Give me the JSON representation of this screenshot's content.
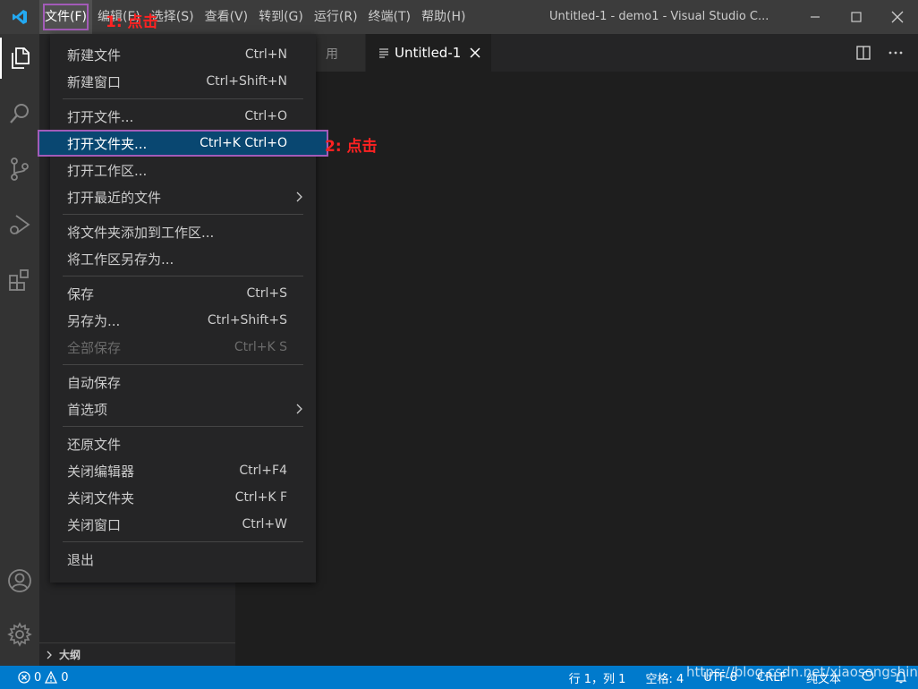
{
  "titlebar": {
    "menus": [
      {
        "label": "文件(F)"
      },
      {
        "label": "编辑(E)"
      },
      {
        "label": "选择(S)"
      },
      {
        "label": "查看(V)"
      },
      {
        "label": "转到(G)"
      },
      {
        "label": "运行(R)"
      },
      {
        "label": "终端(T)"
      },
      {
        "label": "帮助(H)"
      }
    ],
    "window_title": "Untitled-1 - demo1 - Visual Studio C..."
  },
  "tabs": {
    "inactive_label": "用",
    "active_label": "Untitled-1"
  },
  "file_menu": {
    "groups": [
      [
        {
          "label": "新建文件",
          "shortcut": "Ctrl+N"
        },
        {
          "label": "新建窗口",
          "shortcut": "Ctrl+Shift+N"
        }
      ],
      [
        {
          "label": "打开文件...",
          "shortcut": "Ctrl+O"
        },
        {
          "label": "打开文件夹...",
          "shortcut": "Ctrl+K Ctrl+O"
        },
        {
          "label": "打开工作区...",
          "shortcut": ""
        },
        {
          "label": "打开最近的文件",
          "shortcut": ""
        }
      ],
      [
        {
          "label": "将文件夹添加到工作区...",
          "shortcut": ""
        },
        {
          "label": "将工作区另存为...",
          "shortcut": ""
        }
      ],
      [
        {
          "label": "保存",
          "shortcut": "Ctrl+S"
        },
        {
          "label": "另存为...",
          "shortcut": "Ctrl+Shift+S"
        },
        {
          "label": "全部保存",
          "shortcut": "Ctrl+K S"
        }
      ],
      [
        {
          "label": "自动保存",
          "shortcut": ""
        },
        {
          "label": "首选项",
          "shortcut": ""
        }
      ],
      [
        {
          "label": "还原文件",
          "shortcut": ""
        },
        {
          "label": "关闭编辑器",
          "shortcut": "Ctrl+F4"
        },
        {
          "label": "关闭文件夹",
          "shortcut": "Ctrl+K F"
        },
        {
          "label": "关闭窗口",
          "shortcut": "Ctrl+W"
        }
      ],
      [
        {
          "label": "退出",
          "shortcut": ""
        }
      ]
    ]
  },
  "sidebar": {
    "outline_label": "大纲"
  },
  "statusbar": {
    "errors": "0",
    "warnings": "0",
    "position": "行 1，列 1",
    "spaces": "空格: 4",
    "encoding": "UTF-8",
    "eol": "CRLF",
    "language": "纯文本"
  },
  "annotations": {
    "step1": "1: 点击",
    "step2": "2: 点击"
  },
  "watermark": "https://blog.csdn.net/xiaosongshine",
  "colors": {
    "accent": "#007acc",
    "highlight": "#094771",
    "annotation_box": "#a35bb8",
    "annotation_text": "#ff2222"
  }
}
